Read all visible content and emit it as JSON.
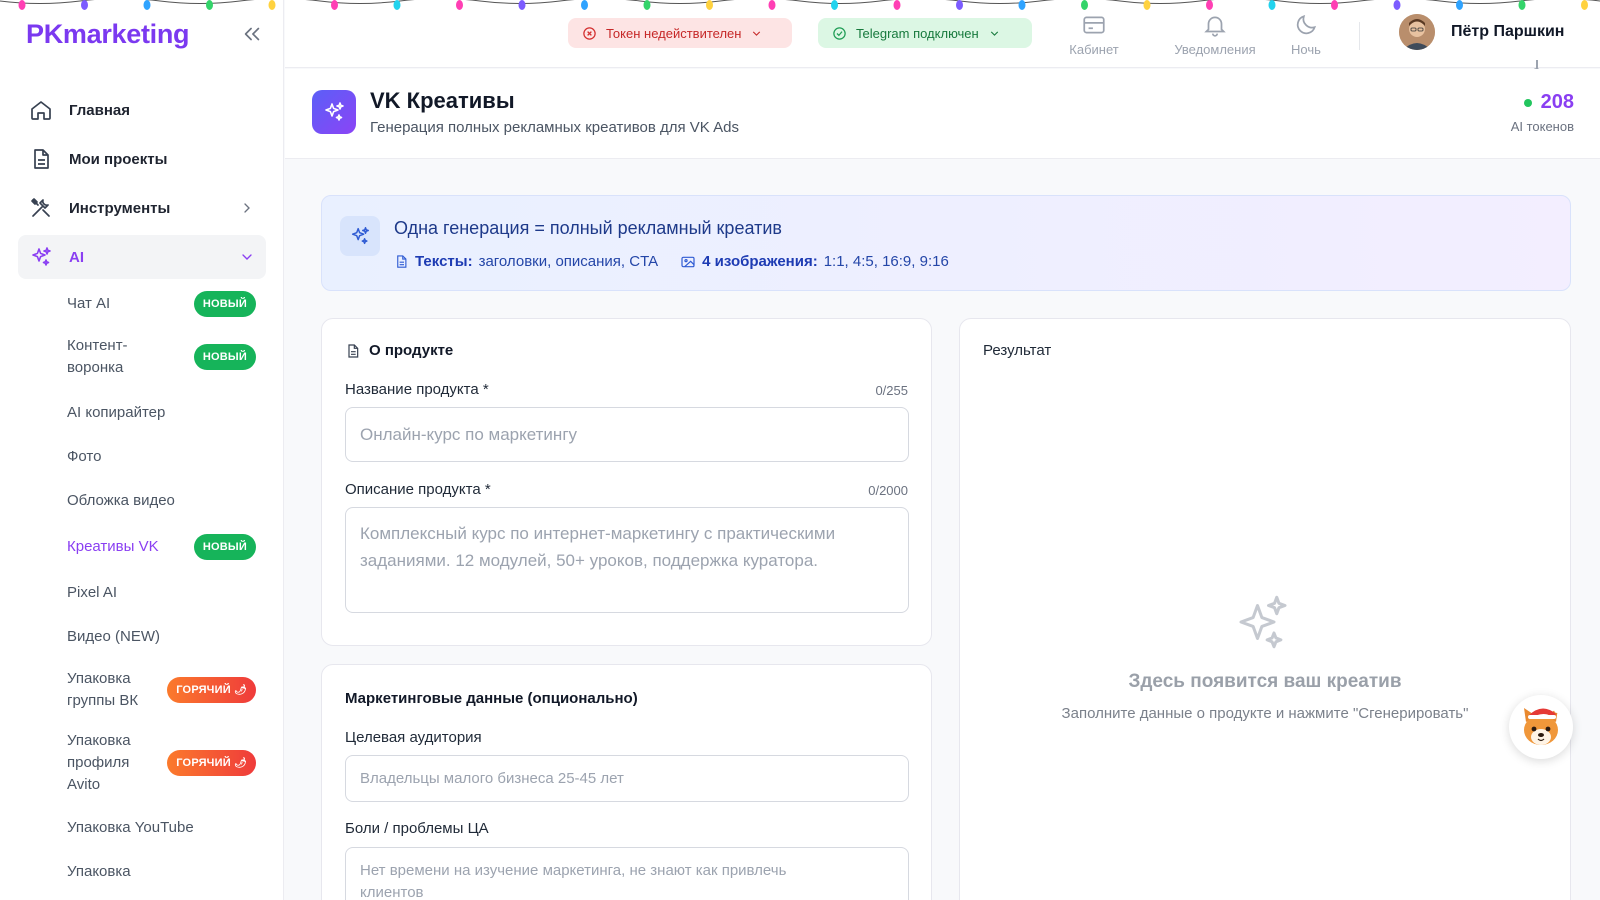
{
  "app": {
    "logo": "PKmarketing"
  },
  "sidebar": {
    "nav": [
      {
        "label": "Главная",
        "icon": "home-icon"
      },
      {
        "label": "Мои проекты",
        "icon": "document-icon"
      },
      {
        "label": "Инструменты",
        "icon": "tools-icon"
      },
      {
        "label": "AI",
        "icon": "sparkles-icon"
      }
    ],
    "sub": [
      {
        "label": "Чат AI",
        "badge": "НОВЫЙ",
        "badge_type": "new"
      },
      {
        "label": "Контент-\nворонка",
        "badge": "НОВЫЙ",
        "badge_type": "new"
      },
      {
        "label": "AI копирайтер",
        "badge": null
      },
      {
        "label": "Фото",
        "badge": null
      },
      {
        "label": "Обложка видео",
        "badge": null
      },
      {
        "label": "Креативы VK",
        "badge": "НОВЫЙ",
        "badge_type": "new",
        "active": true
      },
      {
        "label": "Pixel AI",
        "badge": null
      },
      {
        "label": "Видео (NEW)",
        "badge": null
      },
      {
        "label": "Упаковка\nгруппы ВК",
        "badge": "ГОРЯЧИЙ",
        "badge_type": "hot"
      },
      {
        "label": "Упаковка\nпрофиля\nAvito",
        "badge": "ГОРЯЧИЙ",
        "badge_type": "hot"
      },
      {
        "label": "Упаковка YouTube",
        "badge": null
      },
      {
        "label": "Упаковка",
        "badge": null
      }
    ]
  },
  "topbar": {
    "token_status": "Токен недействителен",
    "telegram_status": "Telegram подключен",
    "cabinet": "Кабинет",
    "notifications": "Уведомления",
    "night": "Ночь",
    "user_name": "Пётр Паршкин"
  },
  "header": {
    "title": "VK Креативы",
    "subtitle": "Генерация полных рекламных креативов для VK Ads",
    "tokens_value": "208",
    "tokens_label": "AI токенов"
  },
  "banner": {
    "title": "Одна генерация = полный рекламный креатив",
    "texts_label": "Тексты:",
    "texts_value": "заголовки, описания, CTA",
    "images_label": "4 изображения:",
    "images_value": "1:1, 4:5, 16:9, 9:16"
  },
  "product": {
    "title": "О продукте",
    "name_label": "Название продукта *",
    "name_counter": "0/255",
    "name_placeholder": "Онлайн-курс по маркетингу",
    "desc_label": "Описание продукта *",
    "desc_counter": "0/2000",
    "desc_placeholder": "Комплексный курс по интернет-маркетингу с практическими заданиями. 12 модулей, 50+ уроков, поддержка куратора."
  },
  "marketing": {
    "title": "Маркетинговые данные (опционально)",
    "audience_label": "Целевая аудитория",
    "audience_placeholder": "Владельцы малого бизнеса 25-45 лет",
    "pains_label": "Боли / проблемы ЦА",
    "pains_placeholder": "Нет времени на изучение маркетинга, не знают как привлечь клиентов"
  },
  "result": {
    "title": "Результат",
    "empty_title": "Здесь появится ваш креатив",
    "empty_subtitle": "Заполните данные о продукте и нажмите \"Сгенерировать\""
  },
  "colors": {
    "brand": "#7b39f0",
    "accent": "#8a3ff2",
    "badge_new": "#16b45a",
    "badge_hot": "#f0542e",
    "error_bg": "#fde4e4",
    "success_bg": "#dcf7e4"
  }
}
